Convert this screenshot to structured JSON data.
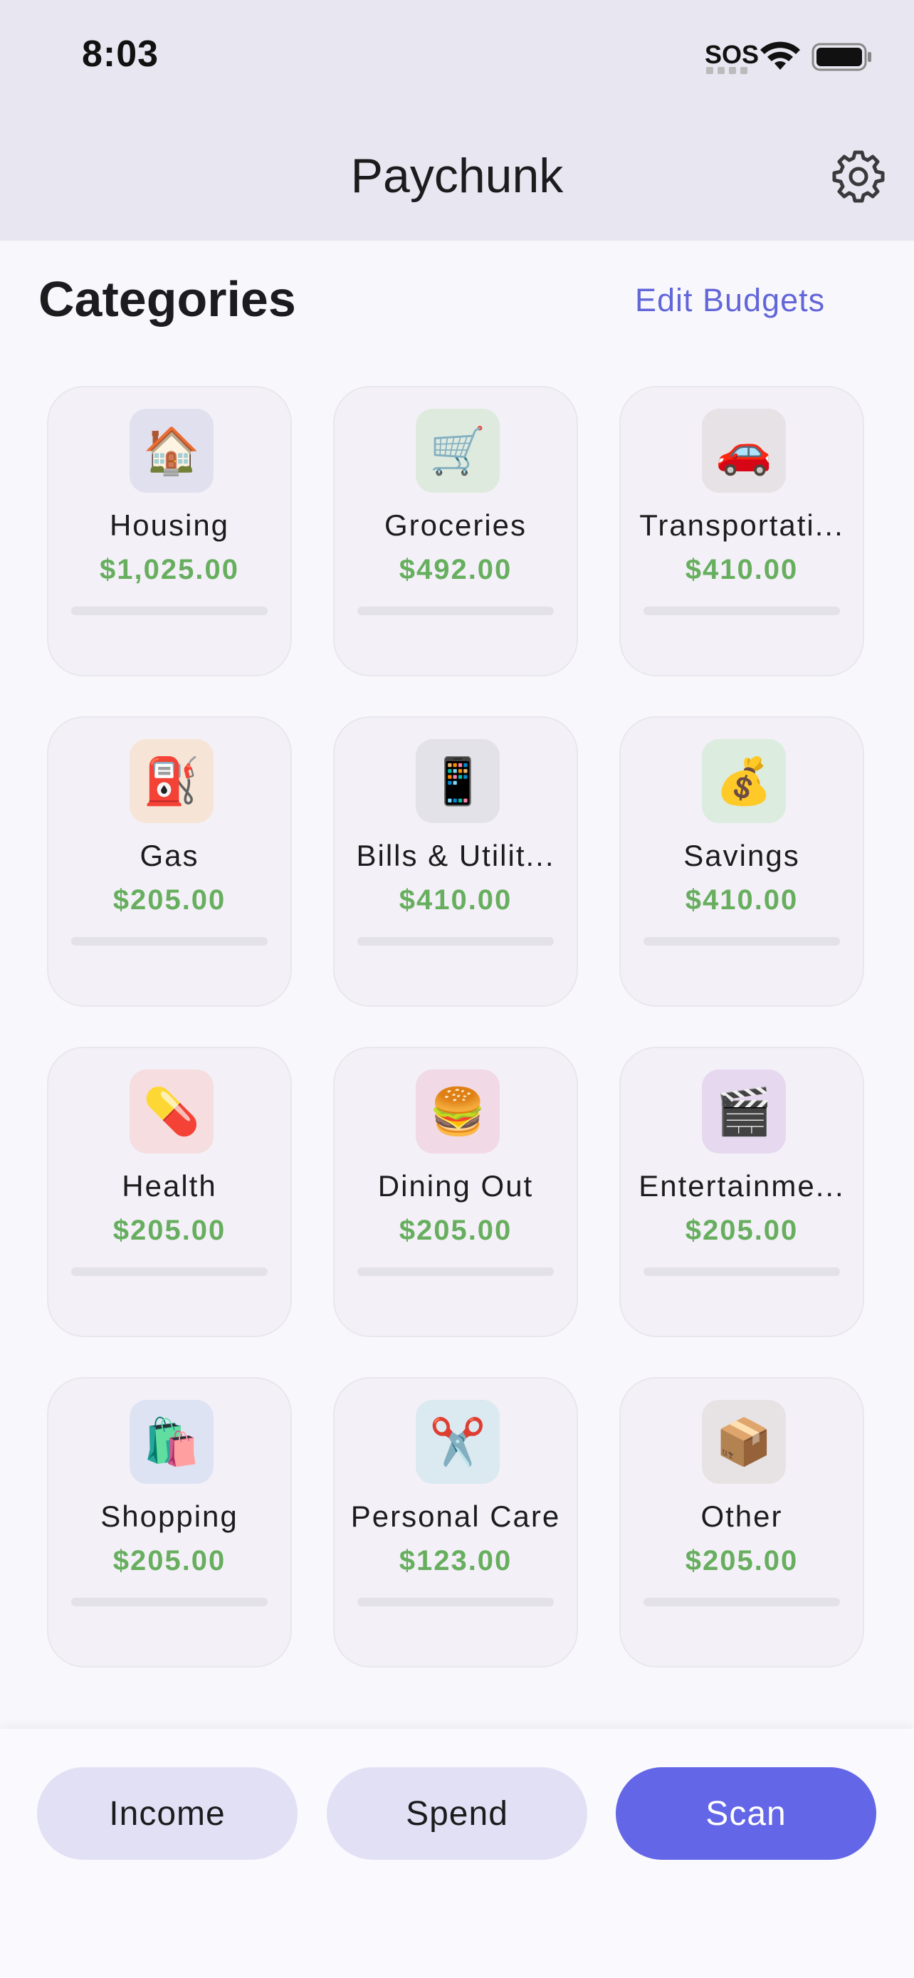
{
  "status_bar": {
    "time": "8:03",
    "carrier": "SOS"
  },
  "header": {
    "title": "Paychunk"
  },
  "section": {
    "title": "Categories",
    "edit_label": "Edit Budgets"
  },
  "categories": [
    {
      "emoji": "🏠",
      "icon_name": "house-icon",
      "name": "Housing",
      "amount": "$1,025.00",
      "progress": 0,
      "icon_bg": "#e0e0ef"
    },
    {
      "emoji": "🛒",
      "icon_name": "shopping-cart-icon",
      "name": "Groceries",
      "amount": "$492.00",
      "progress": 0,
      "icon_bg": "#dfeadf"
    },
    {
      "emoji": "🚗",
      "icon_name": "car-icon",
      "name": "Transportati...",
      "amount": "$410.00",
      "progress": 0,
      "icon_bg": "#e7e2e5"
    },
    {
      "emoji": "⛽",
      "icon_name": "fuel-pump-icon",
      "name": "Gas",
      "amount": "$205.00",
      "progress": 0,
      "icon_bg": "#f6e5d6"
    },
    {
      "emoji": "📱",
      "icon_name": "phone-icon",
      "name": "Bills & Utilit...",
      "amount": "$410.00",
      "progress": 0,
      "icon_bg": "#e3e2e8"
    },
    {
      "emoji": "💰",
      "icon_name": "money-bag-icon",
      "name": "Savings",
      "amount": "$410.00",
      "progress": 0,
      "icon_bg": "#dcecdf"
    },
    {
      "emoji": "💊",
      "icon_name": "pill-icon",
      "name": "Health",
      "amount": "$205.00",
      "progress": 0,
      "icon_bg": "#f5dde0"
    },
    {
      "emoji": "🍔",
      "icon_name": "burger-icon",
      "name": "Dining Out",
      "amount": "$205.00",
      "progress": 0,
      "icon_bg": "#f1d9e5"
    },
    {
      "emoji": "🎬",
      "icon_name": "clapperboard-icon",
      "name": "Entertainme...",
      "amount": "$205.00",
      "progress": 0,
      "icon_bg": "#e6d9ef"
    },
    {
      "emoji": "🛍️",
      "icon_name": "shopping-bags-icon",
      "name": "Shopping",
      "amount": "$205.00",
      "progress": 0,
      "icon_bg": "#dee3f3"
    },
    {
      "emoji": "✂️",
      "icon_name": "scissors-icon",
      "name": "Personal Care",
      "amount": "$123.00",
      "progress": 0,
      "icon_bg": "#dbe9f0"
    },
    {
      "emoji": "📦",
      "icon_name": "package-icon",
      "name": "Other",
      "amount": "$205.00",
      "progress": 0,
      "icon_bg": "#e7e3e5"
    }
  ],
  "actions": {
    "income_label": "Income",
    "spend_label": "Spend",
    "scan_label": "Scan"
  },
  "colors": {
    "accent": "#6366e6",
    "amount": "#67ae5f",
    "link": "#6366d8"
  }
}
